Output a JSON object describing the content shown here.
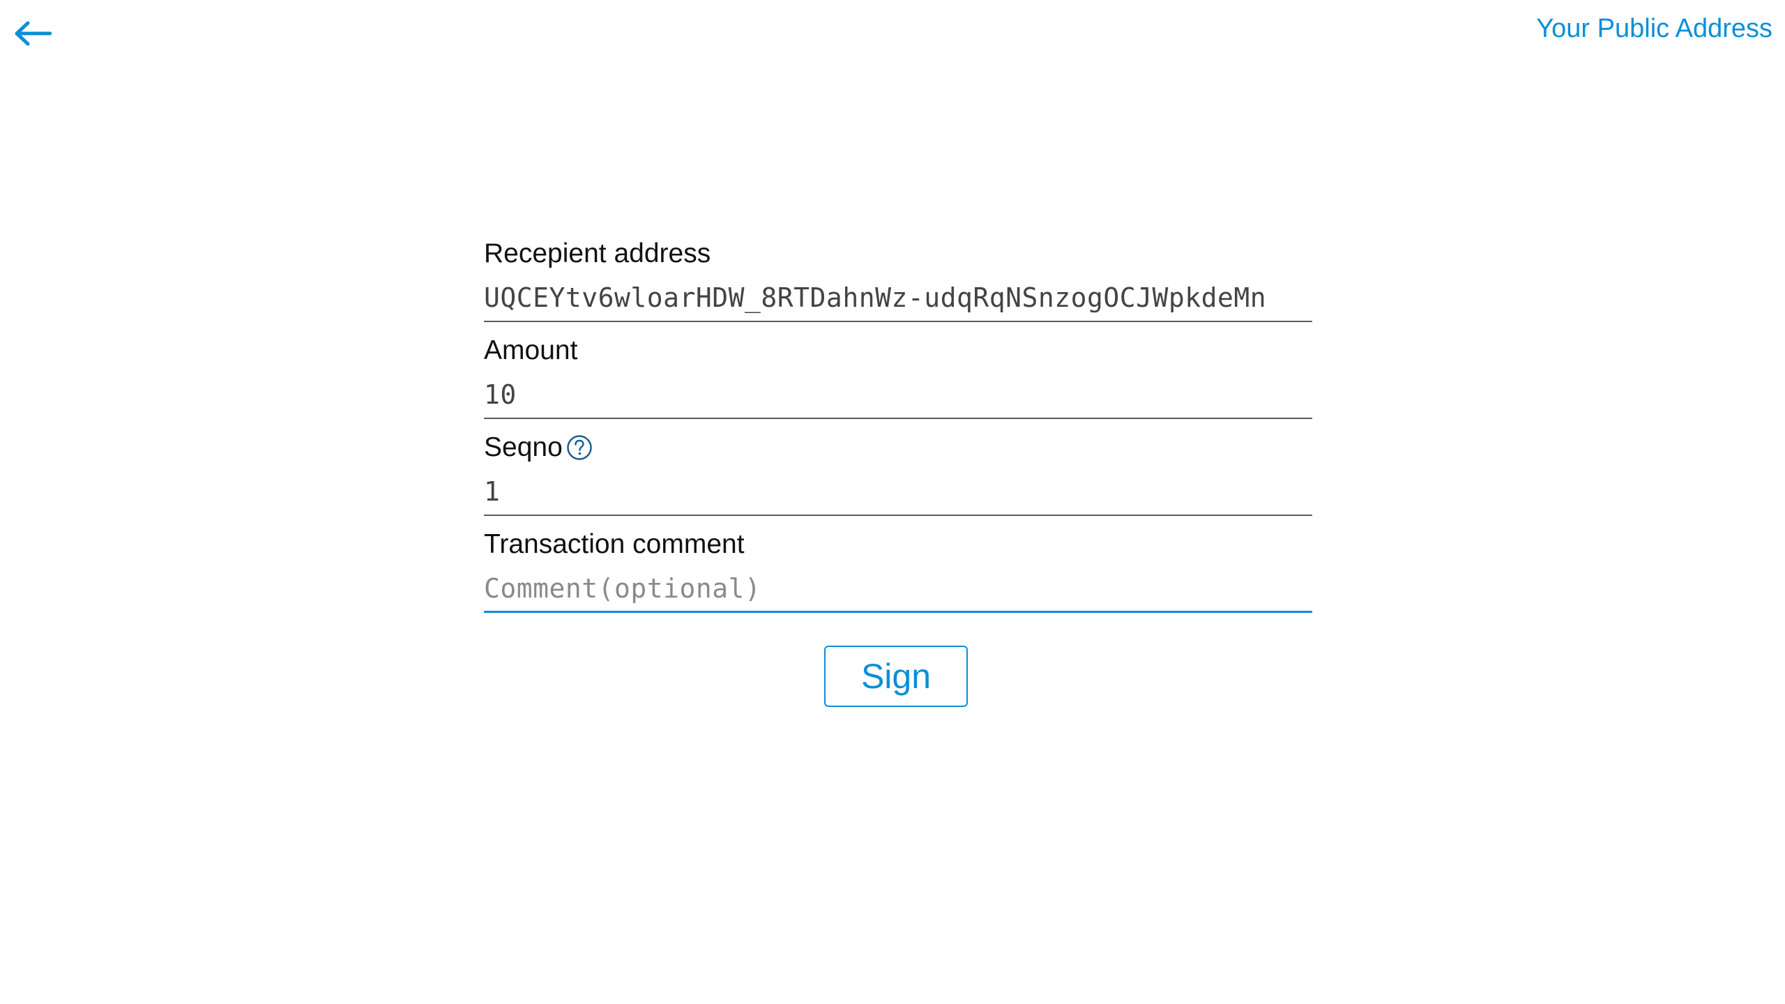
{
  "header": {
    "back_icon": "arrow-left-icon",
    "public_address_label": "Your Public Address",
    "accent_color": "#0b8fd8"
  },
  "form": {
    "recipient": {
      "label": "Recepient address",
      "value": "UQCEYtv6wloarHDW_8RTDahnWz-udqRqNSnzogOCJWpkdeMn"
    },
    "amount": {
      "label": "Amount",
      "value": "10"
    },
    "seqno": {
      "label": "Seqno",
      "help_icon": "question-circle-icon",
      "value": "1"
    },
    "comment": {
      "label": "Transaction comment",
      "value": "",
      "placeholder": "Comment(optional)"
    }
  },
  "actions": {
    "sign_label": "Sign"
  }
}
